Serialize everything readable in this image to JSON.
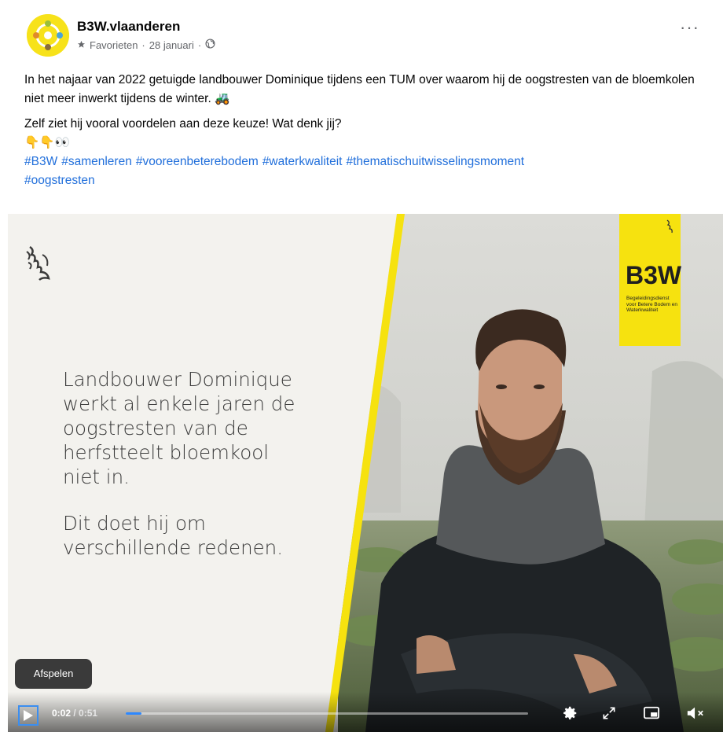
{
  "post": {
    "page_name": "B3W.vlaanderen",
    "favorites_label": "Favorieten",
    "separator": "·",
    "date": "28 januari",
    "more_label": "···",
    "paragraph1": "In het najaar van 2022 getuigde landbouwer Dominique tijdens een TUM over waarom hij de oogstresten van de bloemkolen niet meer inwerkt tijdens de winter. 🚜",
    "paragraph2": "Zelf ziet hij vooral voordelen aan deze keuze! Wat denk jij?",
    "emoji_line": "👇👇👀",
    "hashtags": [
      "#B3W",
      "#samenleren",
      "#vooreenbeterebodem",
      "#waterkwaliteit",
      "#thematischuitwisselingsmoment",
      "#oogstresten"
    ]
  },
  "video": {
    "overlay_line1": "Landbouwer Dominique",
    "overlay_line2": "werkt al enkele jaren de",
    "overlay_line3": "oogstresten van de",
    "overlay_line4": "herfstteelt bloemkool",
    "overlay_line5": "niet in.",
    "overlay_line6": "Dit doet hij om",
    "overlay_line7": "verschillende redenen.",
    "badge_title": "B3W",
    "badge_sub": "Begeleidingsdienst voor Betere Bodem en Waterkwaliteit",
    "brand_color": "#f6e20f"
  },
  "player": {
    "tooltip": "Afspelen",
    "current_time": "0:02",
    "time_separator": " / ",
    "total_time": "0:51",
    "progress": 0.04,
    "accent_color": "#2d88ff"
  }
}
